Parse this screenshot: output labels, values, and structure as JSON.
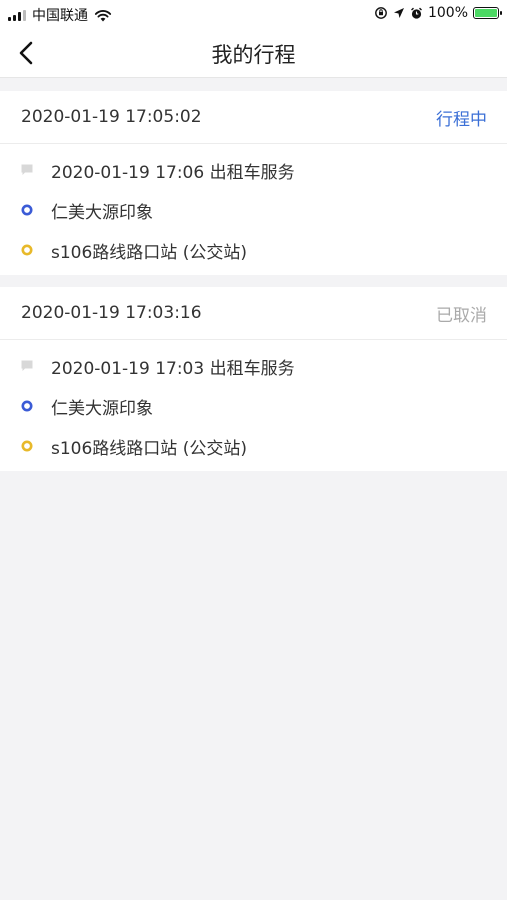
{
  "status_bar": {
    "carrier": "中国联通",
    "battery": "100%"
  },
  "nav": {
    "title": "我的行程"
  },
  "trips": [
    {
      "time": "2020-01-19 17:05:02",
      "status": "行程中",
      "service": "2020-01-19 17:06 出租车服务",
      "start": "仁美大源印象",
      "end": "s106路线路口站 (公交站)"
    },
    {
      "time": "2020-01-19 17:03:16",
      "status": "已取消",
      "service": "2020-01-19 17:03 出租车服务",
      "start": "仁美大源印象",
      "end": "s106路线路口站 (公交站)"
    }
  ],
  "colors": {
    "status_active": "#3b6fd6",
    "status_cancelled": "#aaaaaa",
    "start_dot": "#3b5bd6",
    "end_dot": "#e8b92a"
  }
}
